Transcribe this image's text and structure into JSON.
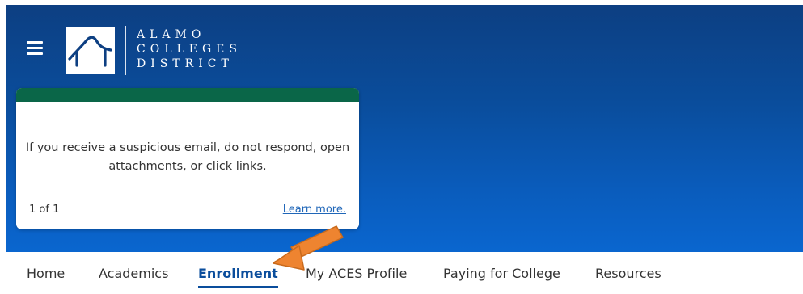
{
  "header": {
    "logo_lines": [
      "ALAMO",
      "COLLEGES",
      "DISTRICT"
    ]
  },
  "alert": {
    "message": "If you receive a suspicious email, do not respond, open attachments, or click links.",
    "counter": "1 of 1",
    "link_label": "Learn more."
  },
  "nav": {
    "items": [
      {
        "label": "Home"
      },
      {
        "label": "Academics"
      },
      {
        "label": "Enrollment"
      },
      {
        "label": "My ACES Profile"
      },
      {
        "label": "Paying for College"
      },
      {
        "label": "Resources"
      }
    ],
    "active": "Enrollment"
  },
  "colors": {
    "hero_blue": "#0a4d9c",
    "alert_green": "#0a6648",
    "annotation_arrow": "#ee8430"
  }
}
